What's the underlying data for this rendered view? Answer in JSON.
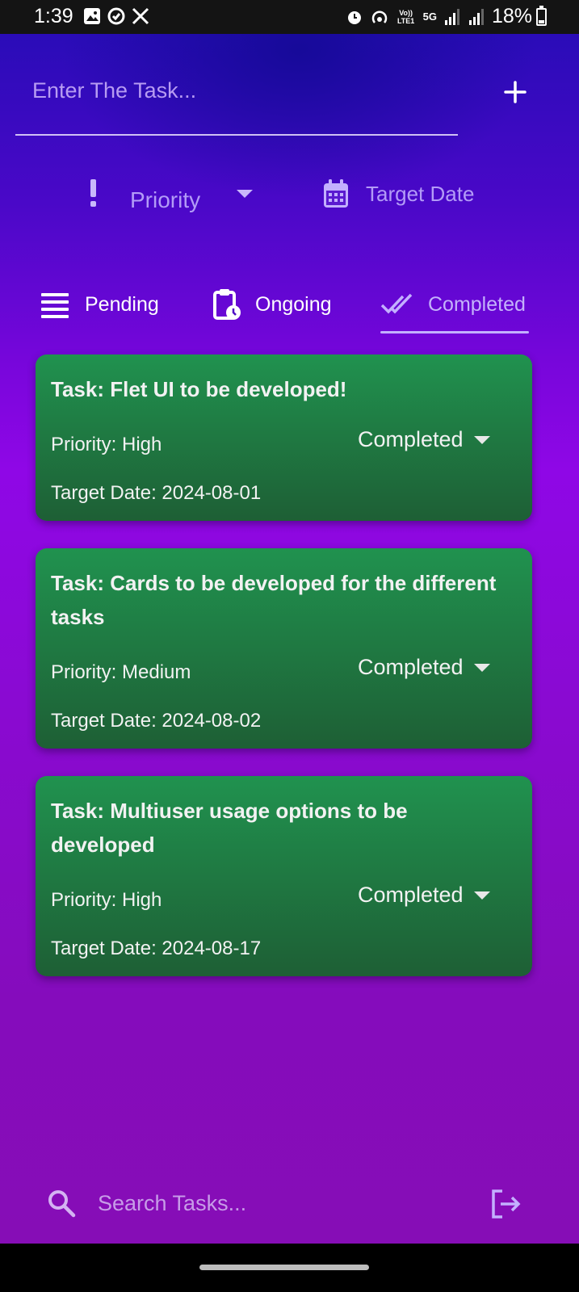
{
  "status_bar": {
    "time": "1:39",
    "left_icons": [
      "gallery-icon",
      "sync-icon",
      "x-logo-icon"
    ],
    "right_icons": [
      "alarm-icon",
      "hotspot-icon",
      "volte-icon",
      "5g-icon",
      "signal-icon",
      "signal-icon",
      "battery-icon"
    ],
    "volte_label": "Vo)) LTE1",
    "network_label": "5G",
    "battery": "18%"
  },
  "task_form": {
    "placeholder": "Enter The Task...",
    "add_icon": "plus-icon",
    "priority_label": "Priority",
    "priority_icon": "exclamation-icon",
    "date_label": "Target Date",
    "date_icon": "calendar-icon"
  },
  "tabs": [
    {
      "label": "Pending",
      "icon": "list-icon"
    },
    {
      "label": "Ongoing",
      "icon": "clipboard-clock-icon"
    },
    {
      "label": "Completed",
      "icon": "double-check-icon",
      "selected": true
    }
  ],
  "tasks": [
    {
      "title": "Task: Flet UI to be developed!",
      "priority": "Priority: High",
      "status": "Completed",
      "target_date": "Target Date: 2024-08-01"
    },
    {
      "title": "Task: Cards to be developed for the different tasks",
      "priority": "Priority: Medium",
      "status": "Completed",
      "target_date": "Target Date: 2024-08-02"
    },
    {
      "title": "Task: Multiuser usage options to be developed",
      "priority": "Priority: High",
      "status": "Completed",
      "target_date": "Target Date: 2024-08-17"
    }
  ],
  "search": {
    "placeholder": "Search Tasks...",
    "icon": "search-icon",
    "logout_icon": "logout-icon"
  },
  "colors": {
    "accent": "#b39bf7",
    "card_green": "#1f7b43",
    "background_top": "#2a0cb8",
    "background_mid": "#8f07e6"
  }
}
